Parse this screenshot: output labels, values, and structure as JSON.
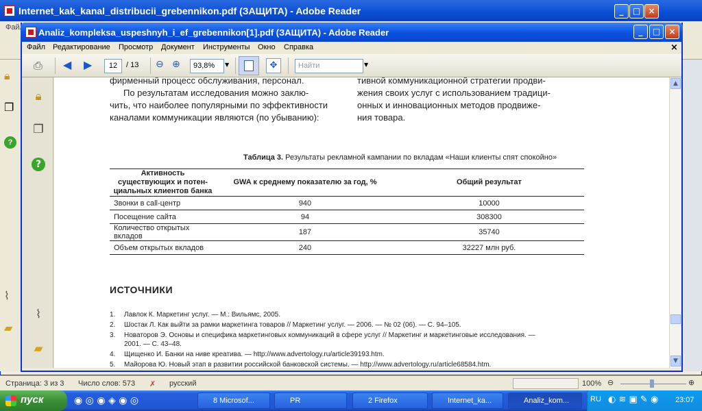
{
  "bg_window": {
    "title": "Internet_kak_kanal_distribucii_grebennikon.pdf (ЗАЩИТА) - Adobe Reader",
    "menu_first": "Файл"
  },
  "window": {
    "title": "Analiz_kompleksa_uspeshnyh_i_ef_grebennikon[1].pdf (ЗАЩИТА) - Adobe Reader",
    "menu": [
      "Файл",
      "Редактирование",
      "Просмотр",
      "Документ",
      "Инструменты",
      "Окно",
      "Справка"
    ],
    "doc_close": "×"
  },
  "toolbar": {
    "page_current": "12",
    "page_total": "/ 13",
    "zoom": "93,8%",
    "search_placeholder": "Найти"
  },
  "document": {
    "left_col": [
      "фирменный процесс обслуживания, персонал.",
      "По результатам исследования можно заклю-",
      "чить, что наиболее популярными по эффективности",
      "каналами коммуникации являются (по убыванию):"
    ],
    "right_col": [
      "тивной коммуникационной стратегии продви-",
      "жения своих услуг с использованием традици-",
      "онных и инновационных методов продвиже-",
      "ния товара."
    ],
    "table_caption_bold": "Таблица 3.",
    "table_caption_rest": " Результаты рекламной кампании по вкладам «Наши клиенты спят спокойно»",
    "table": {
      "headers": [
        "Активность существующих и потен-\nциальных клиентов банка",
        "GWA к среднему показателю за год, %",
        "Общий результат"
      ],
      "rows": [
        [
          "Звонки в call-центр",
          "940",
          "10000"
        ],
        [
          "Посещение сайта",
          "94",
          "308300"
        ],
        [
          "Количество открытых вкладов",
          "187",
          "35740"
        ],
        [
          "Объем открытых вкладов",
          "240",
          "32227 млн руб."
        ]
      ]
    },
    "sources_heading": "ИСТОЧНИКИ",
    "sources": [
      {
        "n": "1.",
        "text": "Лавлок К. Маркетинг услуг. — М.: Вильямс, 2005."
      },
      {
        "n": "2.",
        "text": "Шостак Л. Как выйти за рамки маркетинга товаров // Маркетинг услуг. — 2006. — № 02 (06). — С. 94–105."
      },
      {
        "n": "3.",
        "text": "Новаторов Э. Основы и специфика маркетинговых коммуникаций в сфере услуг // Маркетинг и маркетинговые исследования. —"
      },
      {
        "n": "",
        "text": "2001. — С. 43–48."
      },
      {
        "n": "4.",
        "text": "Щищенко И. Банки на ниве креатива. — http://www.advertology.ru/article39193.htm."
      },
      {
        "n": "5.",
        "text": "Майорова Ю. Новый этап в развитии российской банковской системы. — http://www.advertology.ru/article68584.htm."
      }
    ]
  },
  "status": {
    "page": "Страница: 3 из 3",
    "words": "Число слов: 573",
    "lang": "русский",
    "zoom": "100%"
  },
  "taskbar": {
    "start": "пуск",
    "tasks": [
      "8 Microsof...",
      "PR",
      "2 Firefox",
      "Internet_ka...",
      "Analiz_kom..."
    ],
    "lang": "RU",
    "clock": "23:07"
  },
  "icons": {
    "accent": "#0b54e2"
  }
}
